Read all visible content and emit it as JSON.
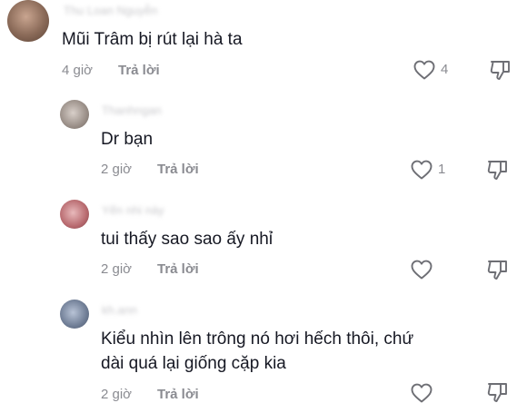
{
  "comments": [
    {
      "username": "Thu Loan Nguyễn",
      "text": "Mũi Trâm bị rút lại hà ta",
      "time": "4 giờ",
      "reply_label": "Trả lời",
      "like_count": "4",
      "avatar_color": "#8a6a58"
    },
    {
      "username": "Thanhngan",
      "text": "Dr bạn",
      "time": "2 giờ",
      "reply_label": "Trả lời",
      "like_count": "1",
      "avatar_color": "#9a8f88"
    },
    {
      "username": "Yến nhi này",
      "text": "tui thấy sao sao ấy nhỉ",
      "time": "2 giờ",
      "reply_label": "Trả lời",
      "like_count": "",
      "avatar_color": "#b86a6f"
    },
    {
      "username": "kh.ann",
      "text": "Kiểu nhìn lên trông nó hơi hếch thôi, chứ dài quá lại giống cặp kia",
      "time": "2 giờ",
      "reply_label": "Trả lời",
      "like_count": "",
      "avatar_color": "#6f7d95"
    }
  ],
  "icons": {
    "like": "heart-outline-icon",
    "dislike": "thumbs-down-icon"
  },
  "colors": {
    "text": "#161823",
    "meta": "#8a8b91"
  }
}
